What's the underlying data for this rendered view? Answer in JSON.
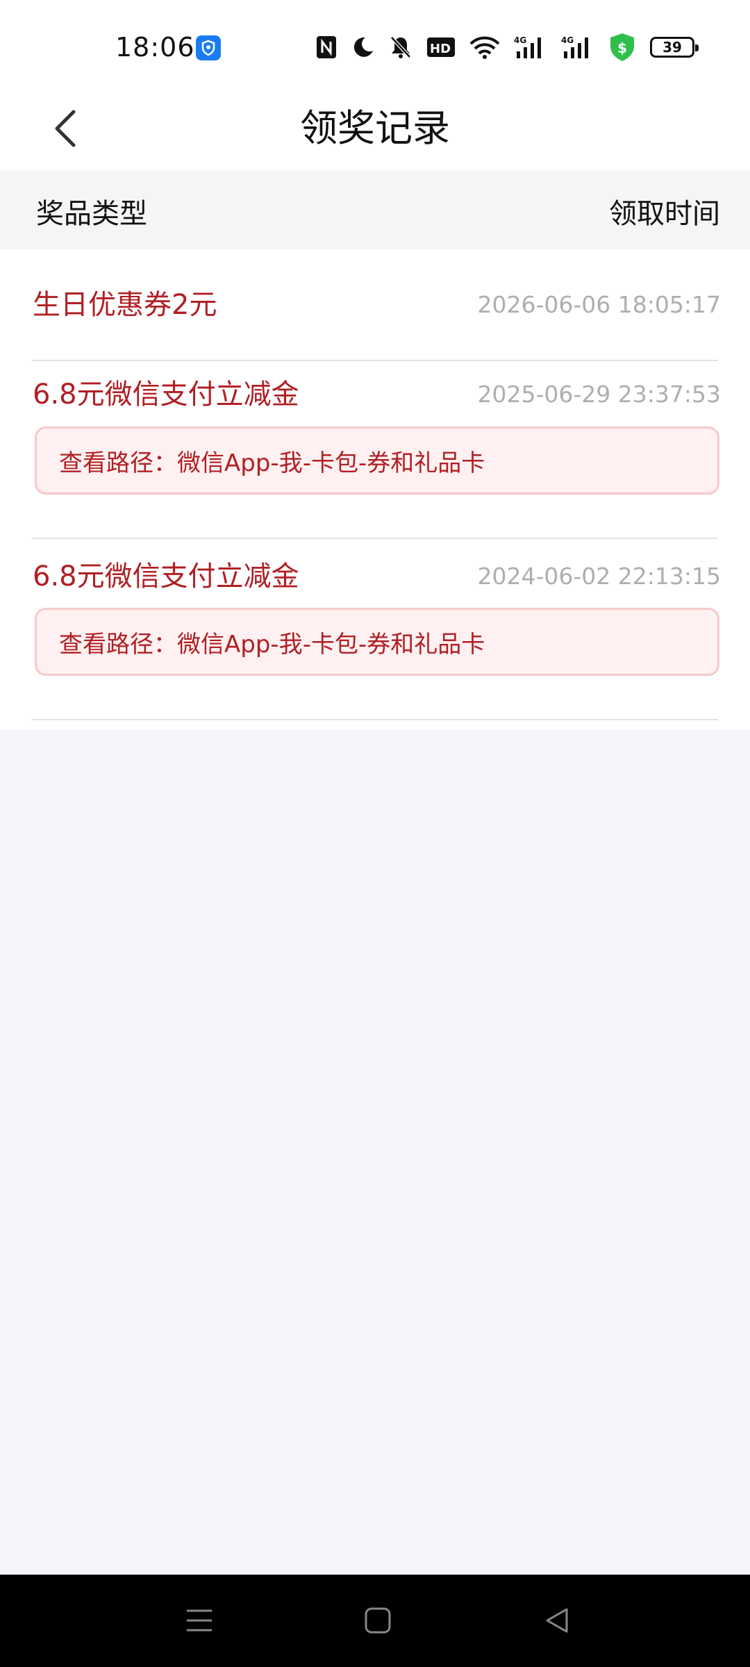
{
  "status_bar": {
    "time": "18:06",
    "battery_level": "39",
    "icons": [
      "nfc-icon",
      "do-not-disturb-icon",
      "mute-icon",
      "hd-icon",
      "wifi-icon",
      "signal-4g-icon",
      "signal-4g-icon",
      "security-shield-icon",
      "battery-icon"
    ],
    "accent_color": "#1a7cf2",
    "shield_color": "#2fbf4a"
  },
  "header": {
    "title": "领奖记录"
  },
  "columns": {
    "left": "奖品类型",
    "right": "领取时间"
  },
  "records": [
    {
      "name": "生日优惠券2元",
      "time": "2026-06-06 18:05:17"
    },
    {
      "name": "6.8元微信支付立减金",
      "time": "2025-06-29 23:37:53",
      "path": "查看路径：微信App-我-卡包-券和礼品卡"
    },
    {
      "name": "6.8元微信支付立减金",
      "time": "2024-06-02 22:13:15",
      "path": "查看路径：微信App-我-卡包-券和礼品卡"
    }
  ],
  "colors": {
    "accent_red": "#b11f24",
    "path_bg": "#fff1f1",
    "path_border": "#f6c9c9",
    "time_gray": "#aeaeae"
  },
  "navigation": {
    "buttons": [
      "menu-icon",
      "home-icon",
      "back-triangle-icon"
    ]
  }
}
